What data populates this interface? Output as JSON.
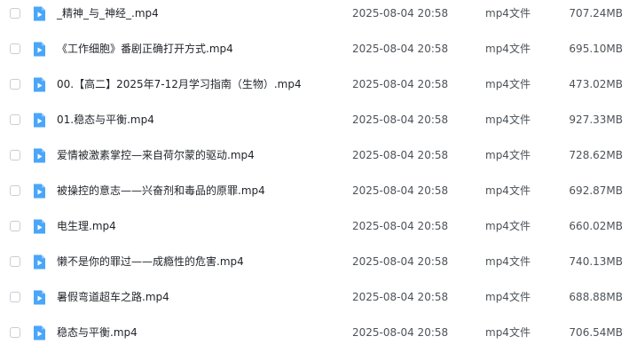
{
  "colors": {
    "video_icon": "#4aa6f8",
    "checkbox_border": "#c9cdd4",
    "text_primary": "#1f2329",
    "text_secondary": "#4e5358"
  },
  "icons": {
    "file": "video-file-icon"
  },
  "files": [
    {
      "name": "_精神_与_神经_.mp4",
      "date": "2025-08-04 20:58",
      "type": "mp4文件",
      "size": "707.24MB"
    },
    {
      "name": "《工作细胞》番剧正确打开方式.mp4",
      "date": "2025-08-04 20:58",
      "type": "mp4文件",
      "size": "695.10MB"
    },
    {
      "name": "00.【高二】2025年7-12月学习指南（生物）.mp4",
      "date": "2025-08-04 20:58",
      "type": "mp4文件",
      "size": "473.02MB"
    },
    {
      "name": "01.稳态与平衡.mp4",
      "date": "2025-08-04 20:58",
      "type": "mp4文件",
      "size": "927.33MB"
    },
    {
      "name": "爱情被激素掌控—来自荷尔蒙的驱动.mp4",
      "date": "2025-08-04 20:58",
      "type": "mp4文件",
      "size": "728.62MB"
    },
    {
      "name": "被操控的意志——兴奋剂和毒品的原罪.mp4",
      "date": "2025-08-04 20:58",
      "type": "mp4文件",
      "size": "692.87MB"
    },
    {
      "name": "电生理.mp4",
      "date": "2025-08-04 20:58",
      "type": "mp4文件",
      "size": "660.02MB"
    },
    {
      "name": "懒不是你的罪过——成瘾性的危害.mp4",
      "date": "2025-08-04 20:58",
      "type": "mp4文件",
      "size": "740.13MB"
    },
    {
      "name": "暑假弯道超车之路.mp4",
      "date": "2025-08-04 20:58",
      "type": "mp4文件",
      "size": "688.88MB"
    },
    {
      "name": "稳态与平衡.mp4",
      "date": "2025-08-04 20:58",
      "type": "mp4文件",
      "size": "706.54MB"
    }
  ]
}
